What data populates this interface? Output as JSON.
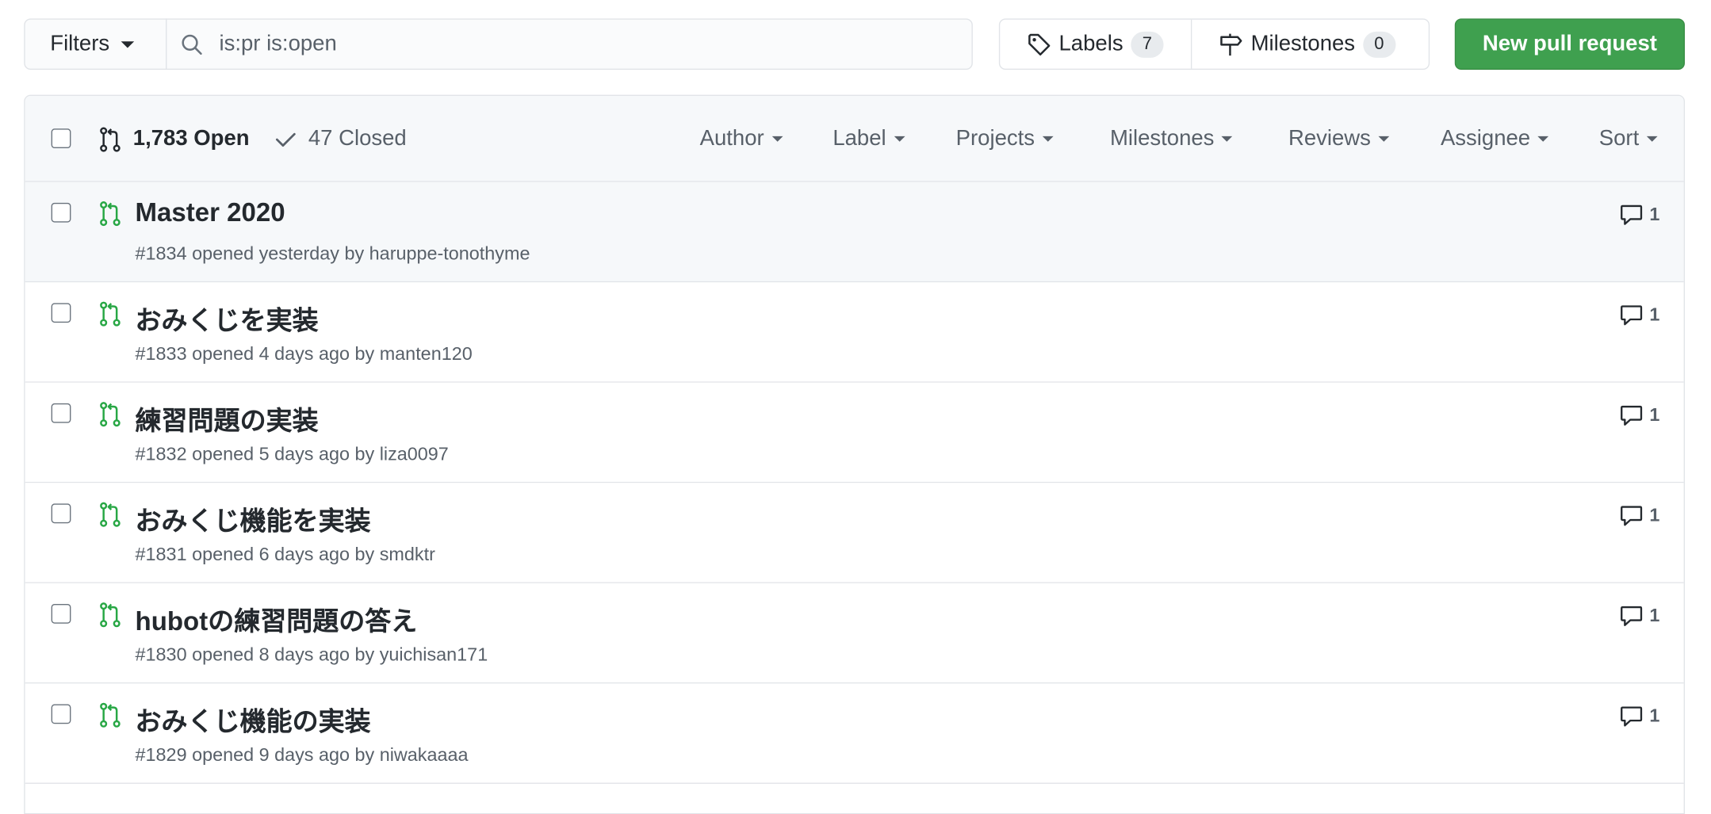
{
  "toolbar": {
    "filters_label": "Filters",
    "search_value": "is:pr is:open",
    "labels_label": "Labels",
    "labels_count": "7",
    "milestones_label": "Milestones",
    "milestones_count": "0",
    "new_pr_label": "New pull request"
  },
  "states": {
    "open_label": "1,783 Open",
    "closed_label": "47 Closed"
  },
  "sort_menus": [
    "Author",
    "Label",
    "Projects",
    "Milestones",
    "Reviews",
    "Assignee",
    "Sort"
  ],
  "pull_requests": [
    {
      "title": "Master 2020",
      "number": "#1834",
      "opened": "opened yesterday",
      "author": "haruppe-tonothyme",
      "comments": "1"
    },
    {
      "title": "おみくじを実装",
      "number": "#1833",
      "opened": "opened 4 days ago",
      "author": "manten120",
      "comments": "1"
    },
    {
      "title": "練習問題の実装",
      "number": "#1832",
      "opened": "opened 5 days ago",
      "author": "liza0097",
      "comments": "1"
    },
    {
      "title": "おみくじ機能を実装",
      "number": "#1831",
      "opened": "opened 6 days ago",
      "author": "smdktr",
      "comments": "1"
    },
    {
      "title": "hubotの練習問題の答え",
      "number": "#1830",
      "opened": "opened 8 days ago",
      "author": "yuichisan171",
      "comments": "1"
    },
    {
      "title": "おみくじ機能の実装",
      "number": "#1829",
      "opened": "opened 9 days ago",
      "author": "niwakaaaa",
      "comments": "1"
    }
  ],
  "colors": {
    "pr_open_green": "#28a745",
    "primary_button": "#3fa04f",
    "muted_text": "#586069",
    "border": "#e1e4e8"
  }
}
